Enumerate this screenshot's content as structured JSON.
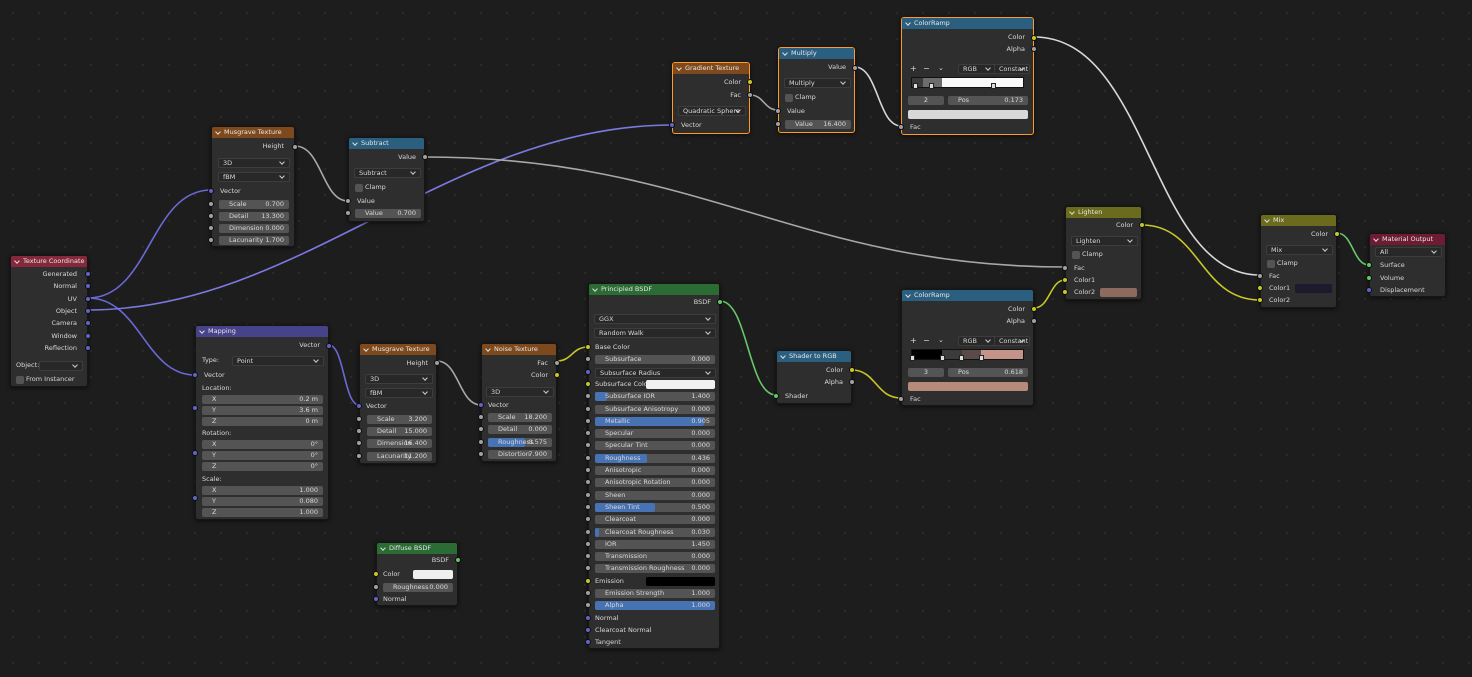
{
  "nodes": {
    "texcoord": {
      "title": "Texture Coordinate",
      "outputs": [
        "Generated",
        "Normal",
        "UV",
        "Object",
        "Camera",
        "Window",
        "Reflection"
      ],
      "object_label": "Object:",
      "from_instancer": "From Instancer"
    },
    "musgrave1": {
      "title": "Musgrave Texture",
      "out": "Height",
      "dim": "3D",
      "type": "fBM",
      "vector": "Vector",
      "fields": [
        {
          "l": "Scale",
          "v": "0.700"
        },
        {
          "l": "Detail",
          "v": "13.300"
        },
        {
          "l": "Dimension",
          "v": "0.000"
        },
        {
          "l": "Lacunarity",
          "v": "1.700"
        }
      ]
    },
    "subtract": {
      "title": "Subtract",
      "out": "Value",
      "op": "Subtract",
      "clamp": "Clamp",
      "in_value": "Value",
      "field": {
        "l": "Value",
        "v": "0.700"
      }
    },
    "gradient": {
      "title": "Gradient Texture",
      "outs": [
        "Color",
        "Fac"
      ],
      "type": "Quadratic Sphere",
      "vector": "Vector"
    },
    "multiply": {
      "title": "Multiply",
      "out": "Value",
      "op": "Multiply",
      "clamp": "Clamp",
      "in_value": "Value",
      "field": {
        "l": "Value",
        "v": "16.400"
      }
    },
    "ramp1": {
      "title": "ColorRamp",
      "outs": [
        "Color",
        "Alpha"
      ],
      "mode": "RGB",
      "interp": "Constant",
      "index": "2",
      "pos_label": "Pos",
      "pos": "0.173",
      "fac": "Fac",
      "swatch": "#d8d8d8"
    },
    "mapping": {
      "title": "Mapping",
      "out": "Vector",
      "type_label": "Type:",
      "type": "Point",
      "vector": "Vector",
      "location": "Location:",
      "loc": [
        {
          "l": "X",
          "v": "0.2 m"
        },
        {
          "l": "Y",
          "v": "3.6 m"
        },
        {
          "l": "Z",
          "v": "0 m"
        }
      ],
      "rotation": "Rotation:",
      "rot": [
        {
          "l": "X",
          "v": "0°"
        },
        {
          "l": "Y",
          "v": "0°"
        },
        {
          "l": "Z",
          "v": "0°"
        }
      ],
      "scale": "Scale:",
      "sc": [
        {
          "l": "X",
          "v": "1.000"
        },
        {
          "l": "Y",
          "v": "0.080"
        },
        {
          "l": "Z",
          "v": "1.000"
        }
      ]
    },
    "musgrave2": {
      "title": "Musgrave Texture",
      "out": "Height",
      "dim": "3D",
      "type": "fBM",
      "vector": "Vector",
      "fields": [
        {
          "l": "Scale",
          "v": "3.200"
        },
        {
          "l": "Detail",
          "v": "15.000"
        },
        {
          "l": "Dimension",
          "v": "16.400"
        },
        {
          "l": "Lacunarity",
          "v": "11.200"
        }
      ]
    },
    "noise": {
      "title": "Noise Texture",
      "outs": [
        "Fac",
        "Color"
      ],
      "dim": "3D",
      "vector": "Vector",
      "fields": [
        {
          "l": "Scale",
          "v": "18.200"
        },
        {
          "l": "Detail",
          "v": "0.000"
        },
        {
          "l": "Roughness",
          "v": "0.575"
        },
        {
          "l": "Distortion",
          "v": "7.900"
        }
      ],
      "roughness_fill": 0.575
    },
    "principled": {
      "title": "Principled BSDF",
      "out": "BSDF",
      "dist": "GGX",
      "sss": "Random Walk",
      "rows": [
        {
          "k": "label",
          "l": "Base Color",
          "s": "y"
        },
        {
          "k": "field",
          "l": "Subsurface",
          "v": "0.000",
          "s": "g",
          "f": 0
        },
        {
          "k": "drop",
          "l": "Subsurface Radius",
          "s": "b"
        },
        {
          "k": "color",
          "l": "Subsurface Color",
          "s": "y",
          "c": "#f0f0f0"
        },
        {
          "k": "field",
          "l": "Subsurface IOR",
          "v": "1.400",
          "s": "g",
          "f": 0.1
        },
        {
          "k": "field",
          "l": "Subsurface Anisotropy",
          "v": "0.000",
          "s": "g",
          "f": 0
        },
        {
          "k": "field",
          "l": "Metallic",
          "v": "0.905",
          "s": "g",
          "f": 0.905
        },
        {
          "k": "field",
          "l": "Specular",
          "v": "0.000",
          "s": "g",
          "f": 0
        },
        {
          "k": "field",
          "l": "Specular Tint",
          "v": "0.000",
          "s": "g",
          "f": 0
        },
        {
          "k": "field",
          "l": "Roughness",
          "v": "0.436",
          "s": "g",
          "f": 0.436
        },
        {
          "k": "field",
          "l": "Anisotropic",
          "v": "0.000",
          "s": "g",
          "f": 0
        },
        {
          "k": "field",
          "l": "Anisotropic Rotation",
          "v": "0.000",
          "s": "g",
          "f": 0
        },
        {
          "k": "field",
          "l": "Sheen",
          "v": "0.000",
          "s": "g",
          "f": 0
        },
        {
          "k": "field",
          "l": "Sheen Tint",
          "v": "0.500",
          "s": "g",
          "f": 0.5
        },
        {
          "k": "field",
          "l": "Clearcoat",
          "v": "0.000",
          "s": "g",
          "f": 0
        },
        {
          "k": "field",
          "l": "Clearcoat Roughness",
          "v": "0.030",
          "s": "g",
          "f": 0.03
        },
        {
          "k": "field",
          "l": "IOR",
          "v": "1.450",
          "s": "g",
          "f": 0
        },
        {
          "k": "field",
          "l": "Transmission",
          "v": "0.000",
          "s": "g",
          "f": 0
        },
        {
          "k": "field",
          "l": "Transmission Roughness",
          "v": "0.000",
          "s": "g",
          "f": 0
        },
        {
          "k": "color",
          "l": "Emission",
          "s": "y",
          "c": "#000000"
        },
        {
          "k": "field",
          "l": "Emission Strength",
          "v": "1.000",
          "s": "g",
          "f": 0
        },
        {
          "k": "field",
          "l": "Alpha",
          "v": "1.000",
          "s": "g",
          "f": 1
        },
        {
          "k": "label",
          "l": "Normal",
          "s": "b"
        },
        {
          "k": "label",
          "l": "Clearcoat Normal",
          "s": "b"
        },
        {
          "k": "label",
          "l": "Tangent",
          "s": "b"
        }
      ]
    },
    "diffuse": {
      "title": "Diffuse BSDF",
      "out": "BSDF",
      "color_label": "Color",
      "color": "#efefef",
      "field": {
        "l": "Roughness",
        "v": "0.000"
      },
      "normal": "Normal"
    },
    "shader2rgb": {
      "title": "Shader to RGB",
      "outs": [
        "Color",
        "Alpha"
      ],
      "shader": "Shader"
    },
    "ramp2": {
      "title": "ColorRamp",
      "outs": [
        "Color",
        "Alpha"
      ],
      "mode": "RGB",
      "interp": "Constant",
      "index": "3",
      "pos_label": "Pos",
      "pos": "0.618",
      "fac": "Fac",
      "swatch": "#b88a7a"
    },
    "lighten": {
      "title": "Lighten",
      "out": "Color",
      "op": "Lighten",
      "clamp": "Clamp",
      "ins": [
        "Fac",
        "Color1",
        "Color2"
      ],
      "color2": "#8c6a5e"
    },
    "mix": {
      "title": "Mix",
      "out": "Color",
      "op": "Mix",
      "clamp": "Clamp",
      "ins": [
        "Fac",
        "Color1",
        "Color2"
      ],
      "color1": "#1e1a2e"
    },
    "output": {
      "title": "Material Output",
      "target": "All",
      "ins": [
        "Surface",
        "Volume",
        "Displacement"
      ]
    }
  }
}
